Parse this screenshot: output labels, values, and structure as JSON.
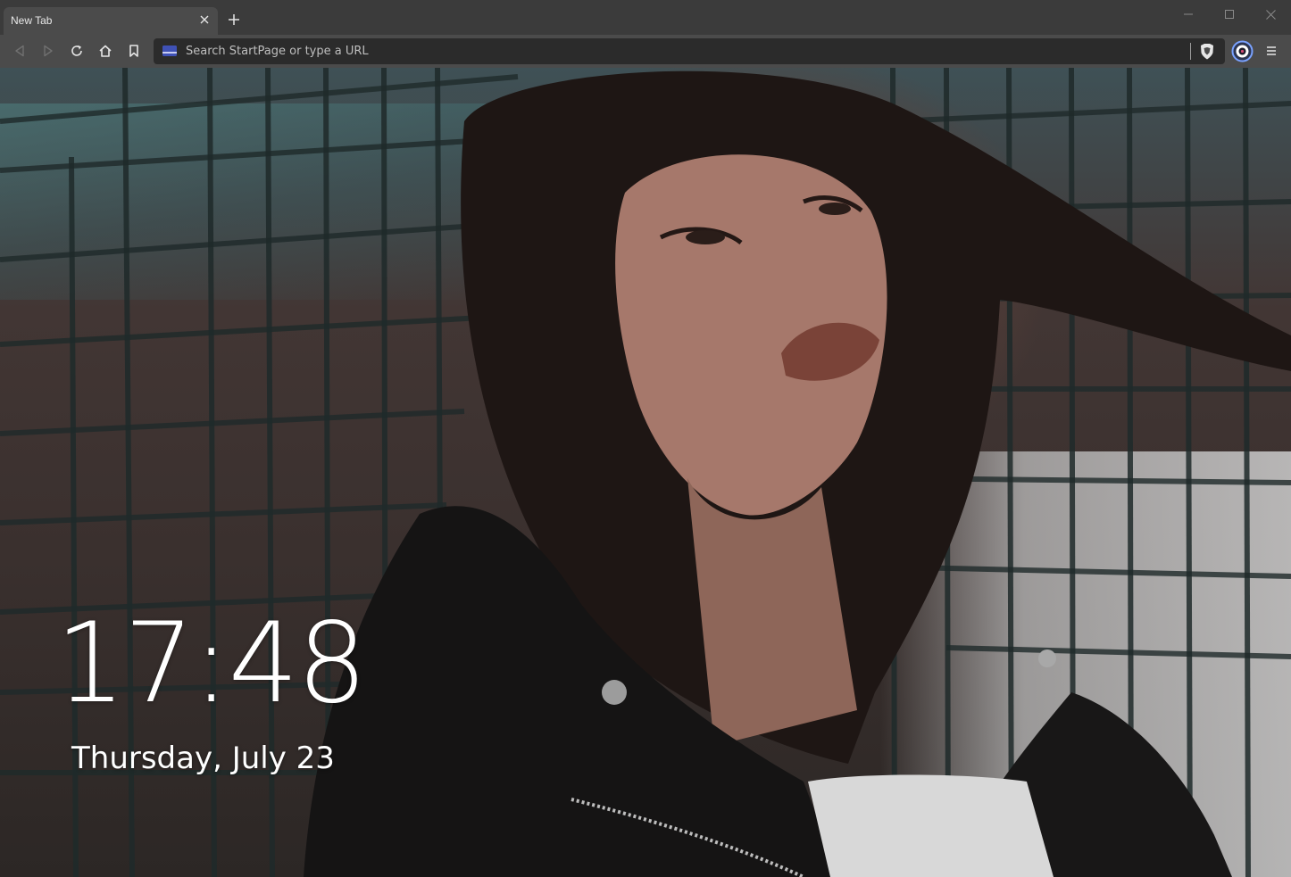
{
  "tabs": [
    {
      "label": "New Tab"
    }
  ],
  "omnibox": {
    "placeholder": "Search StartPage or type a URL"
  },
  "widgets": {
    "clock": {
      "time": "17:48",
      "date": "Thursday, July 23"
    }
  },
  "colors": {
    "tabstrip": "#3b3b3b",
    "toolbar": "#4b4b4b",
    "omnibox": "#2b2b2b",
    "favicon_accent": "#3f51b5",
    "shields_orange": "#fb542b"
  },
  "icons": {
    "back": "arrow-left-icon",
    "forward": "arrow-right-icon",
    "reload": "reload-icon",
    "home": "home-icon",
    "bookmark": "bookmark-icon",
    "shields": "brave-shields-icon",
    "extension": "extension-icon",
    "menu": "hamburger-menu-icon"
  }
}
